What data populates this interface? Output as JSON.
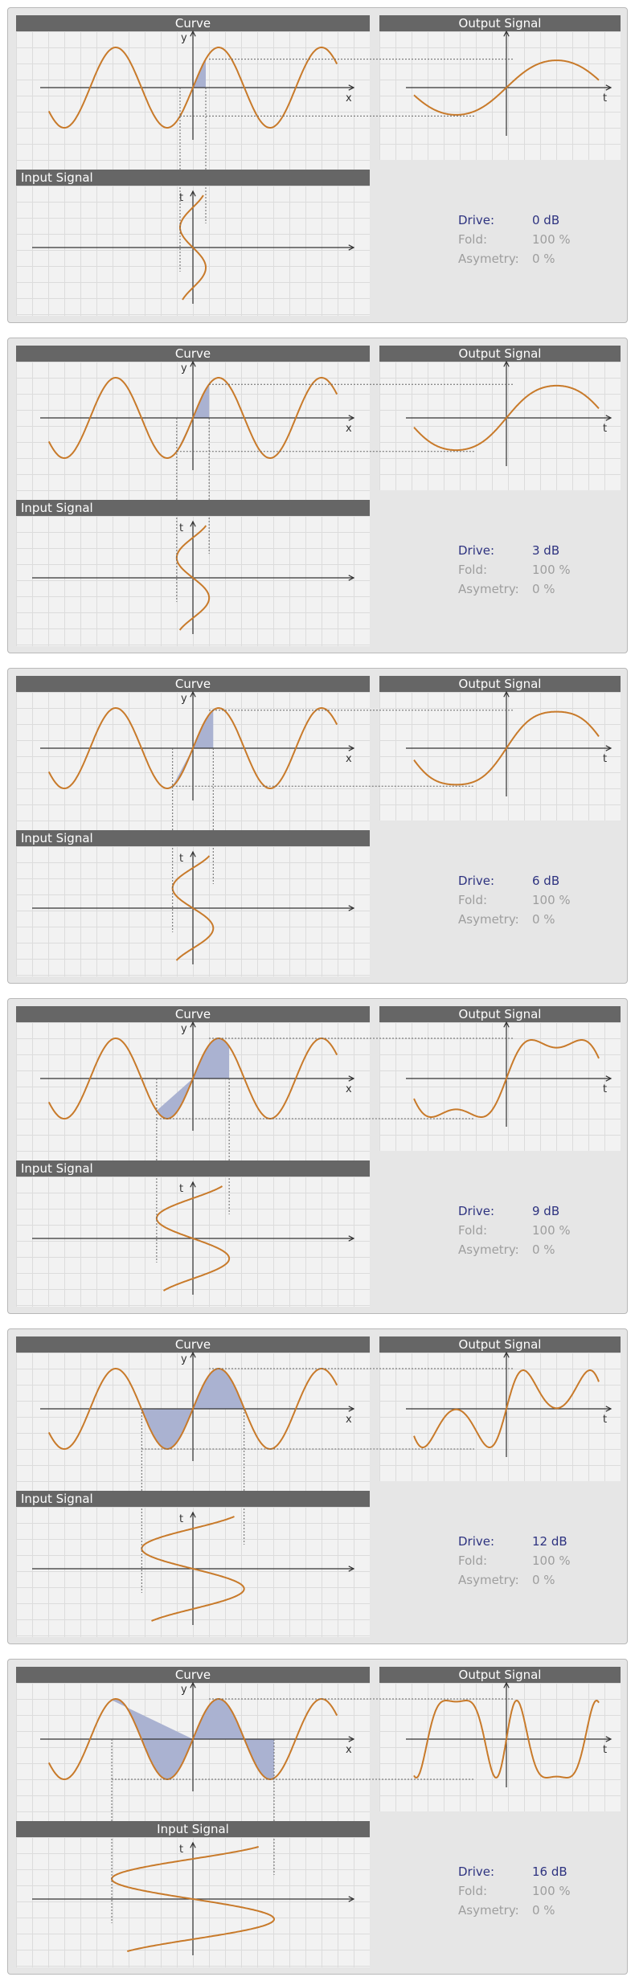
{
  "labels": {
    "curve": "Curve",
    "output": "Output Signal",
    "input": "Input Signal",
    "x_axis": "x",
    "y_axis": "y",
    "t_axis": "t",
    "drive": "Drive:",
    "fold": "Fold:",
    "asymmetry": "Asymetry:"
  },
  "colors": {
    "curve_line": "#c87a2a",
    "fill": "#aab2d1",
    "axis": "#333333",
    "guide": "#666666",
    "drive_text": "#2e3380",
    "dim_text": "#9e9e9e"
  },
  "panels": [
    {
      "drive": "0 dB",
      "fold": "100 %",
      "asymmetry": "0 %",
      "input_header_align": "left"
    },
    {
      "drive": "3 dB",
      "fold": "100 %",
      "asymmetry": "0 %",
      "input_header_align": "left"
    },
    {
      "drive": "6 dB",
      "fold": "100 %",
      "asymmetry": "0 %",
      "input_header_align": "left"
    },
    {
      "drive": "9 dB",
      "fold": "100 %",
      "asymmetry": "0 %",
      "input_header_align": "left"
    },
    {
      "drive": "12 dB",
      "fold": "100 %",
      "asymmetry": "0 %",
      "input_header_align": "left"
    },
    {
      "drive": "16 dB",
      "fold": "100 %",
      "asymmetry": "0 %",
      "input_header_align": "center"
    }
  ]
}
